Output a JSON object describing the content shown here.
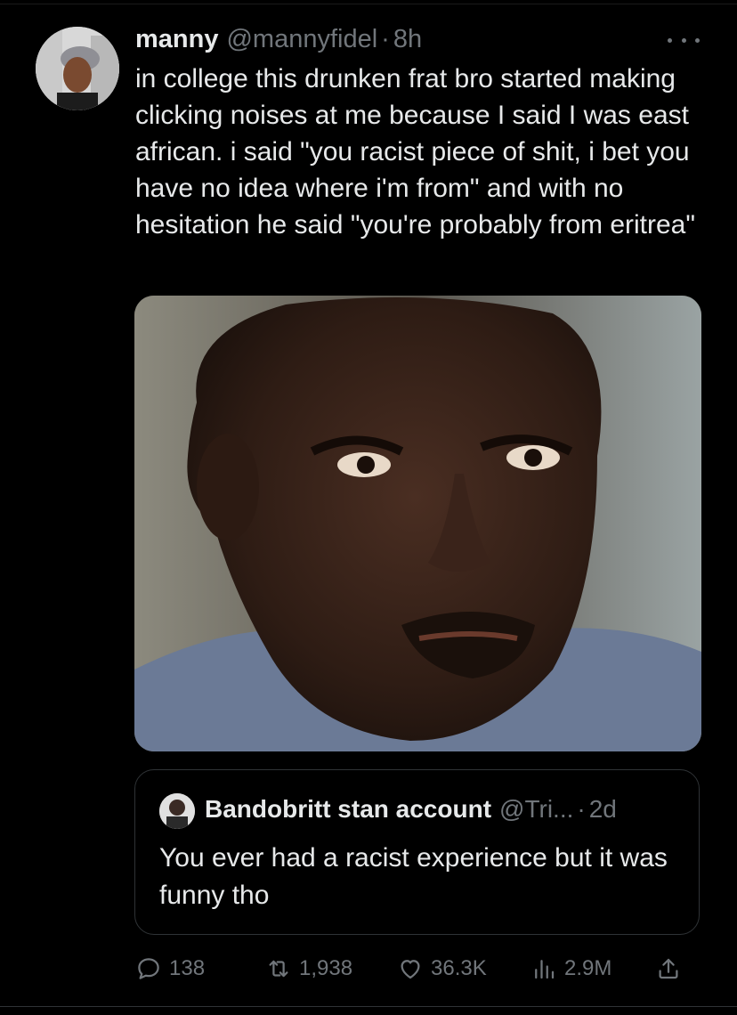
{
  "tweet": {
    "author_name": "manny",
    "author_handle": "@mannyfidel",
    "separator": "·",
    "time": "8h",
    "text": "in college this drunken frat bro started making clicking noises at me because I said I was east african. i said \"you racist piece of shit, i bet you have no idea where i'm from\" and with no hesitation he said \"you're probably from eritrea\""
  },
  "quote": {
    "author_name": "Bandobritt stan account",
    "author_handle": "@Tri...",
    "separator": "·",
    "time": "2d",
    "text": "You ever had a racist experience but it was funny tho"
  },
  "actions": {
    "replies": "138",
    "retweets": "1,938",
    "likes": "36.3K",
    "views": "2.9M"
  },
  "icons": {
    "more": "more-horizontal-icon",
    "reply": "reply-icon",
    "retweet": "retweet-icon",
    "like": "heart-icon",
    "views": "views-chart-icon",
    "share": "share-icon"
  },
  "colors": {
    "background": "#000000",
    "primary_text": "#e7e9ea",
    "secondary_text": "#71767b",
    "border": "#2f3336"
  }
}
